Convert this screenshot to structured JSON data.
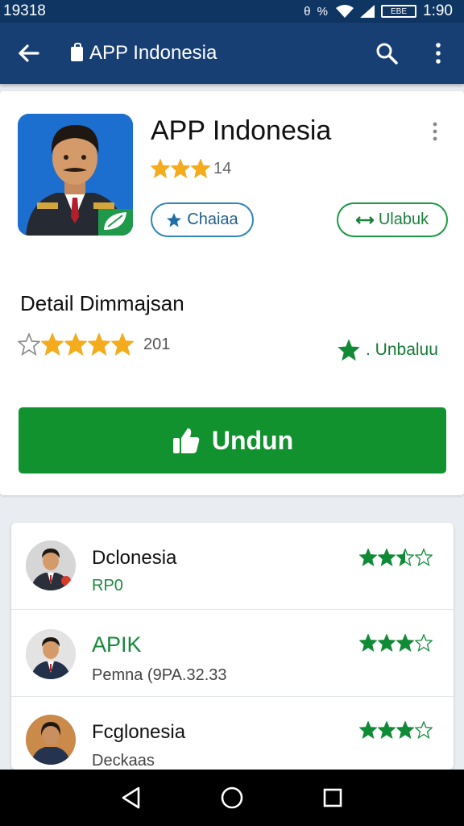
{
  "status": {
    "time_left": "19318",
    "icons_text": "θ %",
    "battery": "EBE",
    "time_right": "1:90"
  },
  "appbar": {
    "title": "APP Indonesia",
    "icons": [
      "back-arrow-icon",
      "bag-icon",
      "search-icon",
      "more-vert-icon"
    ]
  },
  "app": {
    "name": "APP Indonesia",
    "rating_text": "14",
    "rating_value": 3,
    "share_label": "Chaiaa",
    "unblock_label": "Ulabuk"
  },
  "detail": {
    "title": "Detail Dimmajsan",
    "rating_count": "201",
    "rating_value": 4,
    "fav_label": ". Unbaluu",
    "install_label": "Undun"
  },
  "list": [
    {
      "title": "Dclonesia",
      "subtitle": "RP0",
      "rating": 2.5
    },
    {
      "title": "APIK",
      "subtitle": "Pemna (9PA.32.33",
      "rating": 3
    },
    {
      "title": "Fcglonesia",
      "subtitle": "Deckaas",
      "rating": 3
    }
  ],
  "colors": {
    "appbar": "#173f74",
    "status": "#0f3563",
    "install": "#12922f",
    "star_gold": "#f4ab1d",
    "star_green": "#0f8a35"
  }
}
